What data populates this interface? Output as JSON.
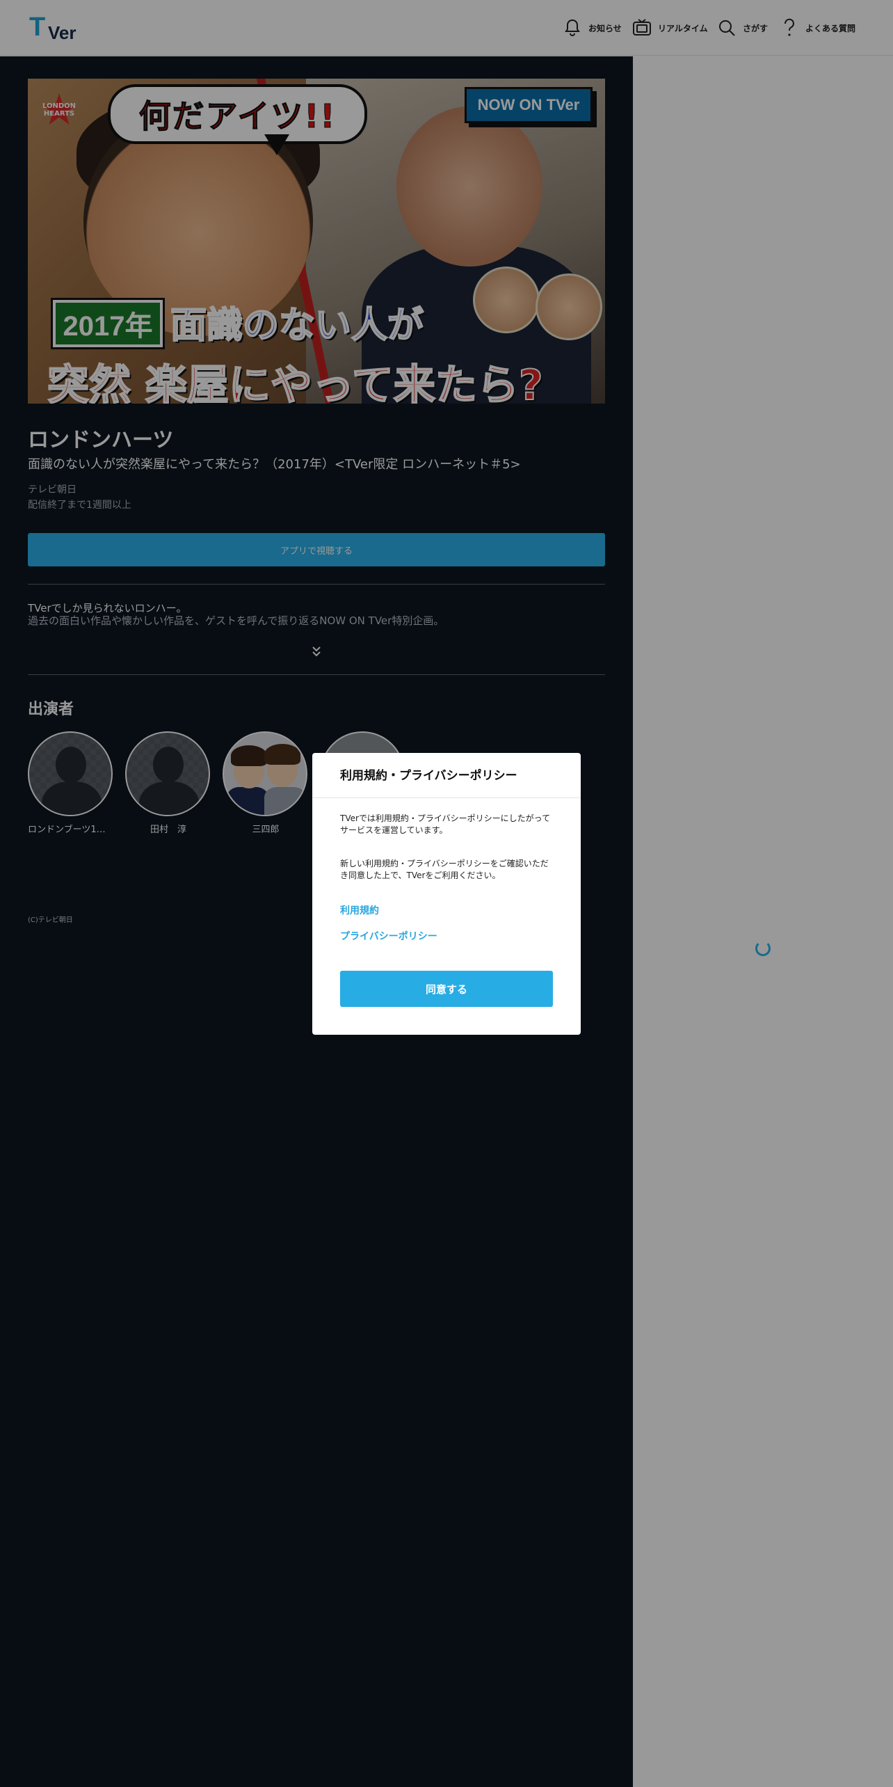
{
  "header": {
    "logo_text_t": "T",
    "logo_text_er": "Ver",
    "nav": [
      {
        "label": "お知らせ",
        "icon": "bell-icon"
      },
      {
        "label": "リアルタイム",
        "icon": "tv-icon"
      },
      {
        "label": "さがす",
        "icon": "search-icon"
      },
      {
        "label": "よくある質問",
        "icon": "question-icon"
      }
    ]
  },
  "thumbnail": {
    "bubble_text": "何だアイツ!!",
    "badge_text": "NOW ON TVer",
    "star_text": "LONDON HEARTS",
    "year_text": "2017年",
    "caption_line1": "面識のない人が",
    "caption_line2": "突然 楽屋にやって来たら?"
  },
  "program": {
    "title": "ロンドンハーツ",
    "episode_title": "面識のない人が突然楽屋にやって来たら？（2017年）<TVer限定 ロンハーネット＃5>",
    "broadcaster": "テレビ朝日",
    "availability": "配信終了まで1週間以上",
    "app_button_label": "アプリで視聴する",
    "description_line1": "TVerでしか見られないロンハー。",
    "description_line2": "過去の面白い作品や懐かしい作品を、ゲストを呼んで振り返るNOW ON TVer特別企画。"
  },
  "cast": {
    "heading": "出演者",
    "members": [
      {
        "name": "ロンドンブーツ1号..."
      },
      {
        "name": "田村　淳"
      },
      {
        "name": "三四郎"
      },
      {
        "name": ""
      }
    ]
  },
  "copyright": "(C)テレビ朝日",
  "modal": {
    "title": "利用規約・プライバシーポリシー",
    "paragraph1": "TVerでは利用規約・プライバシーポリシーにしたがってサービスを運営しています。",
    "paragraph2": "新しい利用規約・プライバシーポリシーをご確認いただき同意した上で、TVerをご利用ください。",
    "link_terms": "利用規約",
    "link_privacy": "プライバシーポリシー",
    "agree_button": "同意する"
  },
  "colors": {
    "accent": "#28ace4",
    "dark_background": "#0c1620"
  }
}
